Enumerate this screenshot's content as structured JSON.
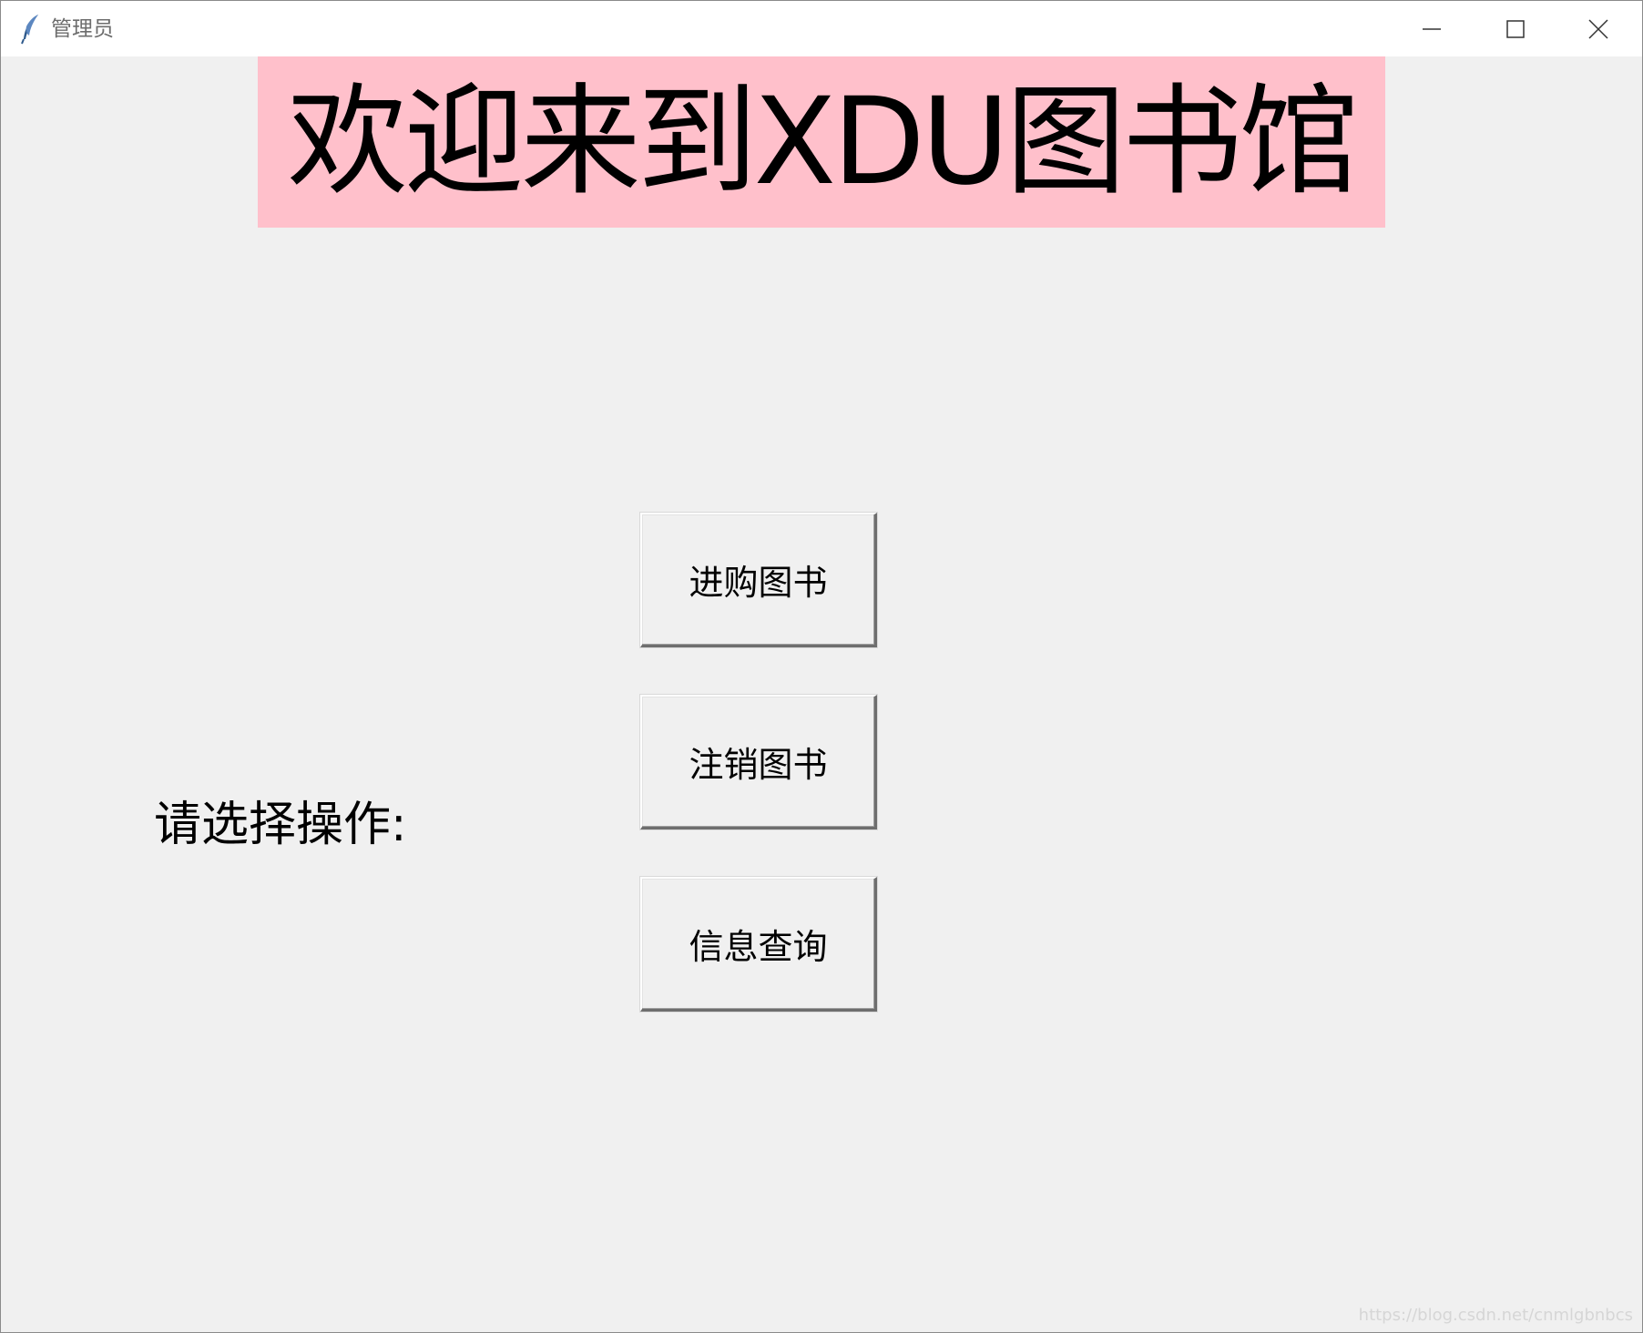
{
  "window": {
    "title": "管理员",
    "app_icon": "tk-feather-icon",
    "controls": {
      "minimize_icon": "minimize-icon",
      "maximize_icon": "maximize-icon",
      "close_icon": "close-icon"
    }
  },
  "main": {
    "banner_text": "欢迎来到XDU图书馆",
    "banner_color": "#ffc0cb",
    "prompt_label": "请选择操作:",
    "buttons": [
      {
        "label": "进购图书"
      },
      {
        "label": "注销图书"
      },
      {
        "label": "信息查询"
      }
    ]
  },
  "watermark": "https://blog.csdn.net/cnmlgbnbcs",
  "colors": {
    "background": "#f0f0f0",
    "titlebar": "#ffffff"
  }
}
